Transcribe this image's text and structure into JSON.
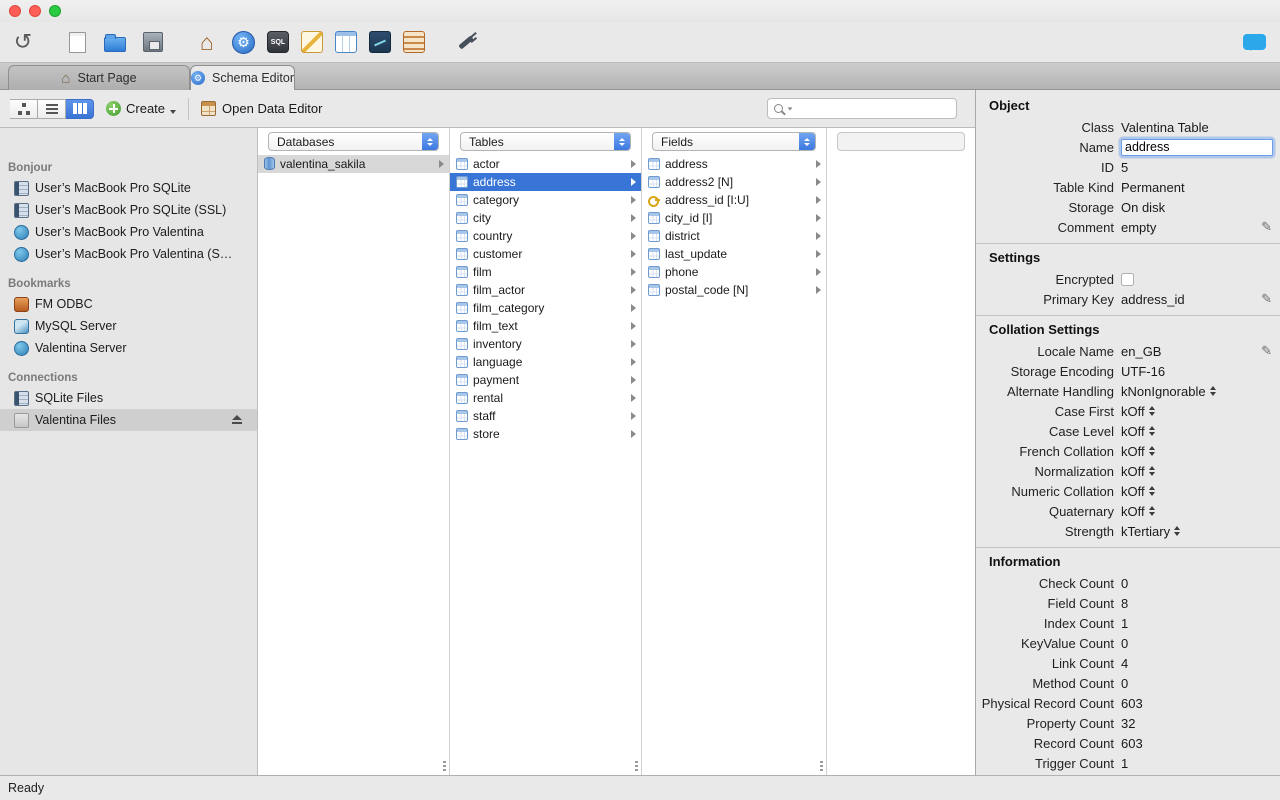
{
  "colors": {
    "selection_blue": "#3875d7",
    "popup_cap_blue": "#3c79e0",
    "create_green": "#3f9e2f",
    "chat_blue": "#2ba8ea",
    "traffic_lights": [
      "#ff5e56",
      "#ff5e56",
      "#2bcb41"
    ]
  },
  "toolbar": {
    "icons": [
      {
        "name": "undo"
      },
      {
        "name": "new-document",
        "gap": true
      },
      {
        "name": "open-folder"
      },
      {
        "name": "save"
      },
      {
        "name": "home",
        "gap": true
      },
      {
        "name": "schema-editor"
      },
      {
        "name": "sql-editor"
      },
      {
        "name": "diagram"
      },
      {
        "name": "table"
      },
      {
        "name": "chart"
      },
      {
        "name": "report"
      },
      {
        "name": "connect",
        "gap": true
      }
    ]
  },
  "tabs": [
    {
      "label": "Start Page",
      "icon": "start-page"
    },
    {
      "label": "Schema Editor",
      "icon": "schema-tab",
      "active": true
    }
  ],
  "subtoolbar": {
    "view_modes": [
      {
        "icon": "tree-view"
      },
      {
        "icon": "list-view"
      },
      {
        "icon": "column-view",
        "selected": true
      }
    ],
    "create_label": "Create",
    "open_data_editor_label": "Open Data Editor",
    "search": {
      "value": "",
      "placeholder": ""
    }
  },
  "sidebar": {
    "sections": [
      {
        "title": "Bonjour",
        "items": [
          {
            "label": "User’s MacBook Pro SQLite",
            "icon": "sqlite"
          },
          {
            "label": "User’s MacBook Pro SQLite (SSL)",
            "icon": "sqlite"
          },
          {
            "label": "User’s MacBook Pro Valentina",
            "icon": "valentina"
          },
          {
            "label": "User’s MacBook Pro Valentina (S…",
            "icon": "valentina"
          }
        ]
      },
      {
        "title": "Bookmarks",
        "items": [
          {
            "label": "FM ODBC",
            "icon": "fm-odbc"
          },
          {
            "label": "MySQL Server",
            "icon": "mysql"
          },
          {
            "label": "Valentina Server",
            "icon": "valentina-server"
          }
        ]
      },
      {
        "title": "Connections",
        "items": [
          {
            "label": "SQLite Files",
            "icon": "sqlite-files"
          },
          {
            "label": "Valentina Files",
            "icon": "valentina-files",
            "selected": true,
            "eject": true
          }
        ]
      }
    ]
  },
  "browser": {
    "columns": [
      {
        "header": "Databases",
        "items": [
          {
            "label": "valentina_sakila",
            "icon": "database",
            "selected": "inactive",
            "arrow": true
          }
        ]
      },
      {
        "header": "Tables",
        "items": [
          {
            "label": "actor",
            "icon": "table",
            "arrow": true
          },
          {
            "label": "address",
            "icon": "table",
            "selected": "active",
            "arrow": true
          },
          {
            "label": "category",
            "icon": "table",
            "arrow": true
          },
          {
            "label": "city",
            "icon": "table",
            "arrow": true
          },
          {
            "label": "country",
            "icon": "table",
            "arrow": true
          },
          {
            "label": "customer",
            "icon": "table",
            "arrow": true
          },
          {
            "label": "film",
            "icon": "table",
            "arrow": true
          },
          {
            "label": "film_actor",
            "icon": "table",
            "arrow": true
          },
          {
            "label": "film_category",
            "icon": "table",
            "arrow": true
          },
          {
            "label": "film_text",
            "icon": "table",
            "arrow": true
          },
          {
            "label": "inventory",
            "icon": "table",
            "arrow": true
          },
          {
            "label": "language",
            "icon": "table",
            "arrow": true
          },
          {
            "label": "payment",
            "icon": "table",
            "arrow": true
          },
          {
            "label": "rental",
            "icon": "table",
            "arrow": true
          },
          {
            "label": "staff",
            "icon": "table",
            "arrow": true
          },
          {
            "label": "store",
            "icon": "table",
            "arrow": true
          }
        ]
      },
      {
        "header": "Fields",
        "items": [
          {
            "label": "address",
            "icon": "field",
            "arrow": true
          },
          {
            "label": "address2 [N]",
            "icon": "field",
            "arrow": true
          },
          {
            "label": "address_id [I:U]",
            "icon": "key",
            "arrow": true
          },
          {
            "label": "city_id [I]",
            "icon": "field",
            "arrow": true
          },
          {
            "label": "district",
            "icon": "field",
            "arrow": true
          },
          {
            "label": "last_update",
            "icon": "field",
            "arrow": true
          },
          {
            "label": "phone",
            "icon": "field",
            "arrow": true
          },
          {
            "label": "postal_code [N]",
            "icon": "field",
            "arrow": true
          }
        ]
      },
      {
        "header": "",
        "items": []
      }
    ]
  },
  "inspector": {
    "sections": [
      {
        "title": "Object",
        "rows": [
          {
            "label": "Class",
            "value": "Valentina Table",
            "type": "text"
          },
          {
            "label": "Name",
            "value": "address",
            "type": "input"
          },
          {
            "label": "ID",
            "value": "5",
            "type": "text"
          },
          {
            "label": "Table Kind",
            "value": "Permanent",
            "type": "text"
          },
          {
            "label": "Storage",
            "value": "On disk",
            "type": "text"
          },
          {
            "label": "Comment",
            "value": "empty",
            "type": "text",
            "edit": true
          }
        ]
      },
      {
        "title": "Settings",
        "rows": [
          {
            "label": "Encrypted",
            "value": "",
            "type": "checkbox"
          },
          {
            "label": "Primary Key",
            "value": "address_id",
            "type": "text",
            "edit": true
          }
        ]
      },
      {
        "title": "Collation Settings",
        "rows": [
          {
            "label": "Locale Name",
            "value": "en_GB",
            "type": "text",
            "edit": true
          },
          {
            "label": "Storage Encoding",
            "value": "UTF-16",
            "type": "text"
          },
          {
            "label": "Alternate Handling",
            "value": "kNonIgnorable",
            "type": "popup"
          },
          {
            "label": "Case First",
            "value": "kOff",
            "type": "popup"
          },
          {
            "label": "Case Level",
            "value": "kOff",
            "type": "popup"
          },
          {
            "label": "French Collation",
            "value": "kOff",
            "type": "popup"
          },
          {
            "label": "Normalization",
            "value": "kOff",
            "type": "popup"
          },
          {
            "label": "Numeric Collation",
            "value": "kOff",
            "type": "popup"
          },
          {
            "label": "Quaternary",
            "value": "kOff",
            "type": "popup"
          },
          {
            "label": "Strength",
            "value": "kTertiary",
            "type": "popup"
          }
        ]
      },
      {
        "title": "Information",
        "rows": [
          {
            "label": "Check Count",
            "value": "0",
            "type": "text"
          },
          {
            "label": "Field Count",
            "value": "8",
            "type": "text"
          },
          {
            "label": "Index Count",
            "value": "1",
            "type": "text"
          },
          {
            "label": "KeyValue Count",
            "value": "0",
            "type": "text"
          },
          {
            "label": "Link Count",
            "value": "4",
            "type": "text"
          },
          {
            "label": "Method Count",
            "value": "0",
            "type": "text"
          },
          {
            "label": "Physical Record Count",
            "value": "603",
            "type": "text"
          },
          {
            "label": "Property Count",
            "value": "32",
            "type": "text"
          },
          {
            "label": "Record Count",
            "value": "603",
            "type": "text"
          },
          {
            "label": "Trigger Count",
            "value": "1",
            "type": "text"
          }
        ]
      }
    ]
  },
  "status_bar": {
    "text": "Ready"
  }
}
